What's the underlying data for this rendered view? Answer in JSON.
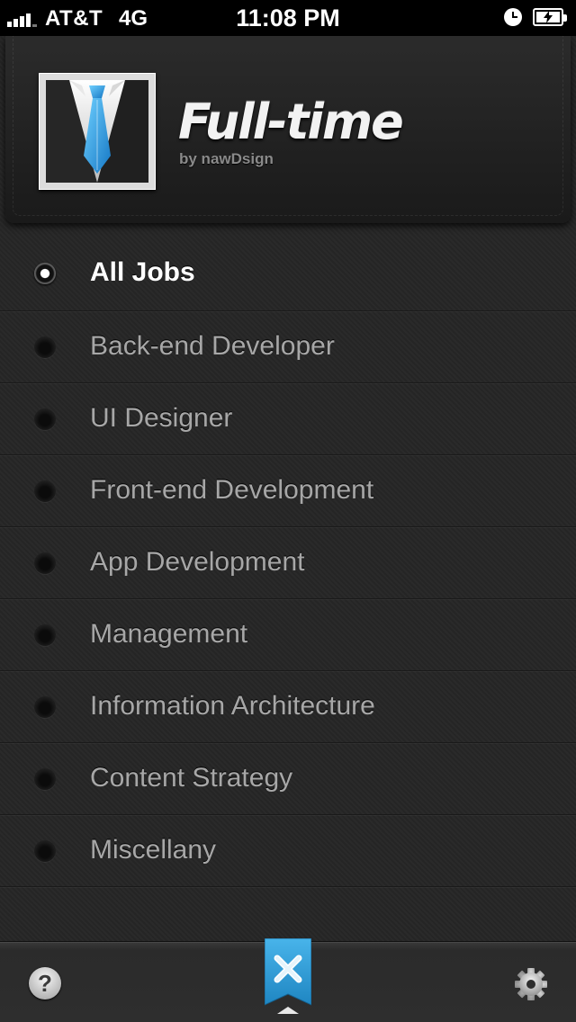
{
  "status_bar": {
    "carrier": "AT&T",
    "network": "4G",
    "time": "11:08 PM"
  },
  "header": {
    "title": "Full-time",
    "subtitle": "by nawDsign"
  },
  "menu": {
    "items": [
      {
        "label": "All Jobs",
        "active": true
      },
      {
        "label": "Back-end Developer",
        "active": false
      },
      {
        "label": "UI Designer",
        "active": false
      },
      {
        "label": "Front-end Development",
        "active": false
      },
      {
        "label": "App Development",
        "active": false
      },
      {
        "label": "Management",
        "active": false
      },
      {
        "label": "Information Architecture",
        "active": false
      },
      {
        "label": "Content Strategy",
        "active": false
      },
      {
        "label": "Miscellany",
        "active": false
      }
    ]
  },
  "toolbar": {
    "help_label": "?",
    "help_icon": "question-icon",
    "close_icon": "close-x-icon",
    "settings_icon": "gear-icon"
  },
  "colors": {
    "accent": "#2f9fd9",
    "background": "#262626",
    "active_text": "#ffffff",
    "inactive_text": "#a7a7a7"
  }
}
